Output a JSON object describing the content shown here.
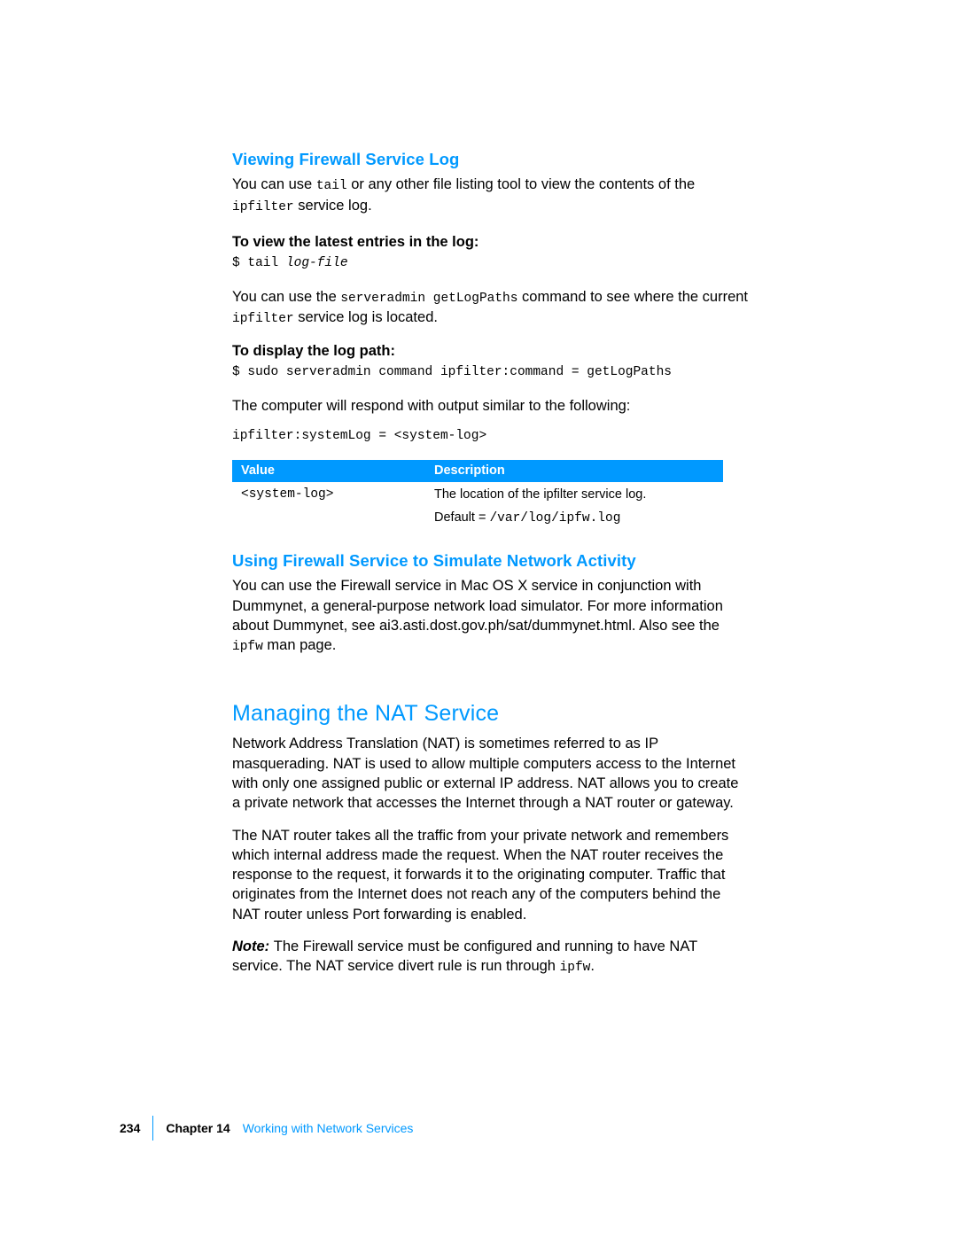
{
  "section1": {
    "heading": "Viewing Firewall Service Log",
    "p1a": "You can use ",
    "p1_code": "tail",
    "p1b": " or any other file listing tool to view the contents of the ",
    "p1_code2": "ipfilter",
    "p1c": " service log.",
    "sub1": "To view the latest entries in the log:",
    "code1a": "$ tail ",
    "code1b": "log-file",
    "p2a": "You can use the ",
    "p2_code": "serveradmin getLogPaths",
    "p2b": " command to see where the current ",
    "p2_code2": "ipfilter",
    "p2c": " service log is located.",
    "sub2": "To display the log path:",
    "code2": "$ sudo serveradmin command ipfilter:command = getLogPaths",
    "p3": "The computer will respond with output similar to the following:",
    "code3": "ipfilter:systemLog = <system-log>"
  },
  "table": {
    "h1": "Value",
    "h2": "Description",
    "r1c1": "<system-log>",
    "r1c2": "The location of the ipfilter service log.",
    "r2c2a": "Default = ",
    "r2c2b": "/var/log/ipfw.log"
  },
  "section2": {
    "heading": "Using Firewall Service to Simulate Network Activity",
    "p1a": "You can use the Firewall service in Mac OS X service in conjunction with Dummynet, a general-purpose network load simulator. For more information about Dummynet, see ai3.asti.dost.gov.ph/sat/dummynet.html. Also see the ",
    "p1_code": "ipfw",
    "p1b": " man page."
  },
  "section3": {
    "heading": "Managing the NAT Service",
    "p1": "Network Address Translation (NAT) is sometimes referred to as IP masquerading. NAT is used to allow multiple computers access to the Internet with only one assigned public or external IP address. NAT allows you to create a private network that accesses the Internet through a NAT router or gateway.",
    "p2": "The NAT router takes all the traffic from your private network and remembers which internal address made the request. When the NAT router receives the response to the request, it forwards it to the originating computer. Traffic that originates from the Internet does not reach any of the computers behind the NAT router unless Port forwarding is enabled.",
    "note_label": "Note:  ",
    "note_a": "The Firewall service must be configured and running to have NAT service. The NAT service divert rule is run through ",
    "note_code": "ipfw",
    "note_b": "."
  },
  "footer": {
    "page": "234",
    "chapter": "Chapter 14",
    "title": "Working with Network Services"
  }
}
